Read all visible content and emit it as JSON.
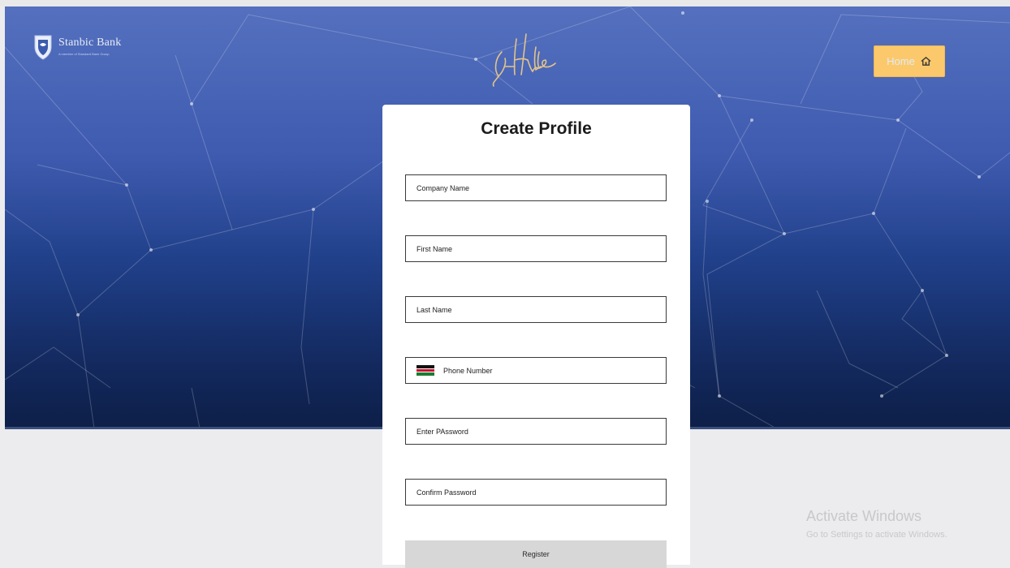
{
  "header": {
    "brand_name": "Stanbic Bank",
    "brand_tagline": "A member of Standard Bank Group",
    "home_label": "Home"
  },
  "form": {
    "title": "Create Profile",
    "company_name_placeholder": "Company Name",
    "first_name_placeholder": "First Name",
    "last_name_placeholder": "Last Name",
    "phone_placeholder": "Phone Number",
    "password_placeholder": "Enter PAssword",
    "confirm_password_placeholder": "Confirm Password",
    "register_label": "Register",
    "country_flag_icon": "kenya-flag-icon"
  },
  "watermark": {
    "title": "Activate Windows",
    "subtitle": "Go to Settings to activate Windows."
  },
  "colors": {
    "hero_top": "#5470be",
    "hero_bottom": "#0d1f48",
    "home_button": "#fbc96b",
    "page_background": "#ececee",
    "register_button": "#d7d7d7"
  }
}
